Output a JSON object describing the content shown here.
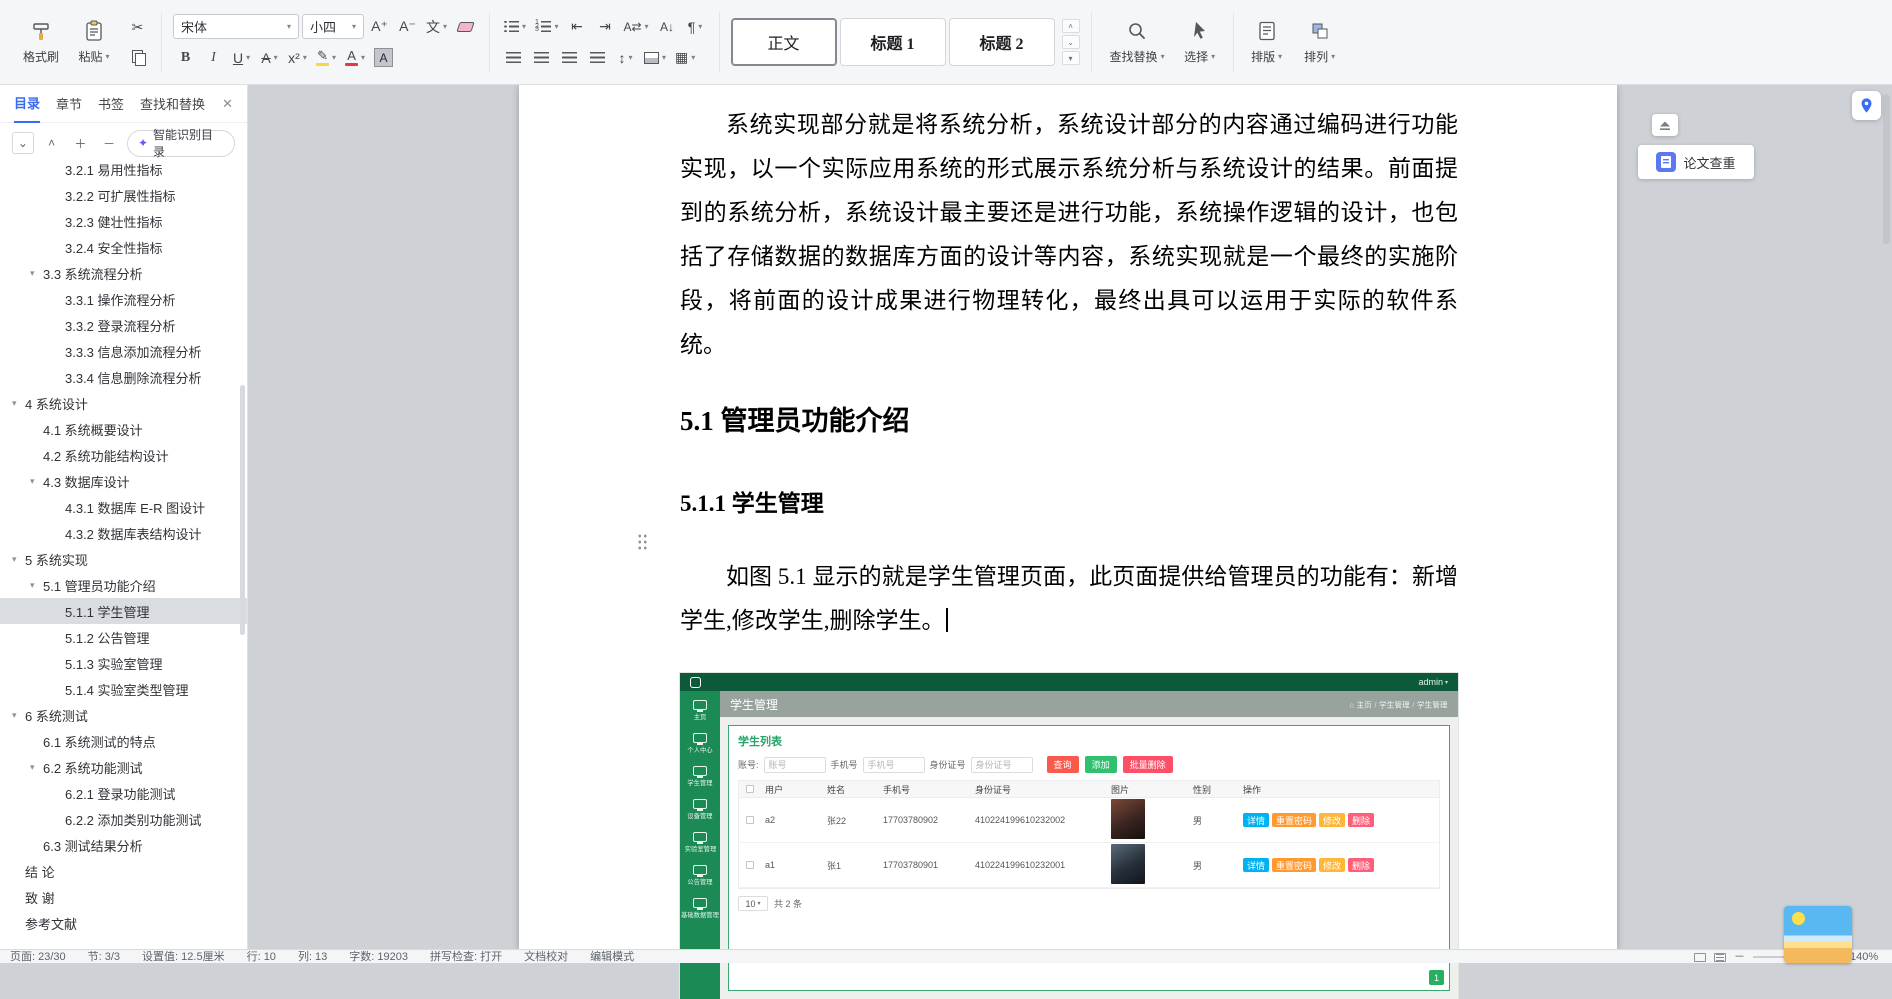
{
  "glyphs": {
    "caret_down": "▾",
    "triangle_down": "▾",
    "cut": "✂",
    "bold": "B",
    "italic": "I",
    "underline": "U",
    "strike": "A",
    "superscript": "x²",
    "effects": "文",
    "highlight": "✎",
    "font_color": "A",
    "char_shading": "A",
    "grow": "A⁺",
    "shrink": "A⁻",
    "outdent": "⇤",
    "indent": "⇥",
    "char_scale": "A⇄",
    "sort": "A↓",
    "paragraph_mark": "¶",
    "line_spacing": "↕",
    "borders": "▦",
    "chevron_up": "˄",
    "chevron_down": "⌄",
    "plus": "＋",
    "minus": "－",
    "close": "✕",
    "spark": "✦",
    "home": "⌂",
    "crumb_sep": "/"
  },
  "ribbon": {
    "clipboard": {
      "format_painter": "格式刷",
      "paste": "粘贴"
    },
    "font": {
      "family": "宋体",
      "size": "小四"
    },
    "styles": {
      "items": [
        {
          "label": "正文"
        },
        {
          "label": "标题 1"
        },
        {
          "label": "标题 2"
        }
      ]
    },
    "tools": {
      "find_replace": "查找替换",
      "select": "选择",
      "typeset": "排版",
      "arrange": "排列"
    }
  },
  "left_panel": {
    "tabs": [
      "目录",
      "章节",
      "书签",
      "查找和替换"
    ],
    "smart_toc": "智能识别目录",
    "toc": [
      {
        "text": "3.2.1 易用性指标",
        "level": 3
      },
      {
        "text": "3.2.2 可扩展性指标",
        "level": 3
      },
      {
        "text": "3.2.3 健壮性指标",
        "level": 3
      },
      {
        "text": "3.2.4 安全性指标",
        "level": 3
      },
      {
        "text": "3.3 系统流程分析",
        "level": 2,
        "expand": true
      },
      {
        "text": "3.3.1 操作流程分析",
        "level": 3
      },
      {
        "text": "3.3.2 登录流程分析",
        "level": 3
      },
      {
        "text": "3.3.3 信息添加流程分析",
        "level": 3
      },
      {
        "text": "3.3.4 信息删除流程分析",
        "level": 3
      },
      {
        "text": "4 系统设计",
        "level": 1,
        "expand": true
      },
      {
        "text": "4.1 系统概要设计",
        "level": 2
      },
      {
        "text": "4.2 系统功能结构设计",
        "level": 2
      },
      {
        "text": "4.3 数据库设计",
        "level": 2,
        "expand": true
      },
      {
        "text": "4.3.1 数据库 E-R 图设计",
        "level": 3
      },
      {
        "text": "4.3.2 数据库表结构设计",
        "level": 3
      },
      {
        "text": "5 系统实现",
        "level": 1,
        "expand": true
      },
      {
        "text": "5.1 管理员功能介绍",
        "level": 2,
        "expand": true
      },
      {
        "text": "5.1.1 学生管理",
        "level": 3,
        "active": true
      },
      {
        "text": "5.1.2 公告管理",
        "level": 3
      },
      {
        "text": "5.1.3 实验室管理",
        "level": 3
      },
      {
        "text": "5.1.4 实验室类型管理",
        "level": 3
      },
      {
        "text": "6 系统测试",
        "level": 1,
        "expand": true
      },
      {
        "text": "6.1 系统测试的特点",
        "level": 2
      },
      {
        "text": "6.2 系统功能测试",
        "level": 2,
        "expand": true
      },
      {
        "text": "6.2.1 登录功能测试",
        "level": 3
      },
      {
        "text": "6.2.2 添加类别功能测试",
        "level": 3
      },
      {
        "text": "6.3 测试结果分析",
        "level": 2
      },
      {
        "text": "结  论",
        "level": 1
      },
      {
        "text": "致  谢",
        "level": 1
      },
      {
        "text": "参考文献",
        "level": 1
      }
    ]
  },
  "document": {
    "para1": "系统实现部分就是将系统分析，系统设计部分的内容通过编码进行功能实现，以一个实际应用系统的形式展示系统分析与系统设计的结果。前面提到的系统分析，系统设计最主要还是进行功能，系统操作逻辑的设计，也包括了存储数据的数据库方面的设计等内容，系统实现就是一个最终的实施阶段，将前面的设计成果进行物理转化，最终出具可以运用于实际的软件系统。",
    "heading1": "5.1  管理员功能介绍",
    "heading2": "5.1.1  学生管理",
    "para2": "如图 5.1 显示的就是学生管理页面，此页面提供给管理员的功能有：新增学生,修改学生,删除学生。"
  },
  "app": {
    "user": "admin",
    "sidebar": [
      "主页",
      "个人中心",
      "学生管理",
      "设备管理",
      "实验室管理",
      "公告管理",
      "基础数据管理"
    ],
    "title": "学生管理",
    "breadcrumb": [
      "主页",
      "学生管理",
      "学生管理"
    ],
    "panel_title": "学生列表",
    "filters": [
      {
        "label": "账号:",
        "placeholder": "账号"
      },
      {
        "label": "手机号",
        "placeholder": "手机号"
      },
      {
        "label": "身份证号",
        "placeholder": "身份证号"
      }
    ],
    "buttons": {
      "search": "查询",
      "add": "添加",
      "batch_delete": "批量删除"
    },
    "table": {
      "headers": [
        "用户",
        "姓名",
        "手机号",
        "身份证号",
        "图片",
        "性别",
        "操作"
      ],
      "rows": [
        {
          "account": "a2",
          "name": "张22",
          "phone": "17703780902",
          "idcard": "410224199610232002",
          "gender": "男"
        },
        {
          "account": "a1",
          "name": "张1",
          "phone": "17703780901",
          "idcard": "410224199610232001",
          "gender": "男"
        }
      ],
      "row_actions": [
        "详情",
        "重置密码",
        "修改",
        "删除"
      ]
    },
    "pagination": {
      "size": "10",
      "total": "共 2 条",
      "page": "1"
    }
  },
  "right_rail": {
    "paper_check": "论文查重"
  },
  "status_bar": {
    "items": [
      "页面: 23/30",
      "节: 3/3",
      "设置值: 12.5厘米",
      "行: 10",
      "列: 13",
      "字数: 19203",
      "拼写检查: 打开",
      "文档校对",
      "编辑模式"
    ],
    "zoom": "140%"
  }
}
